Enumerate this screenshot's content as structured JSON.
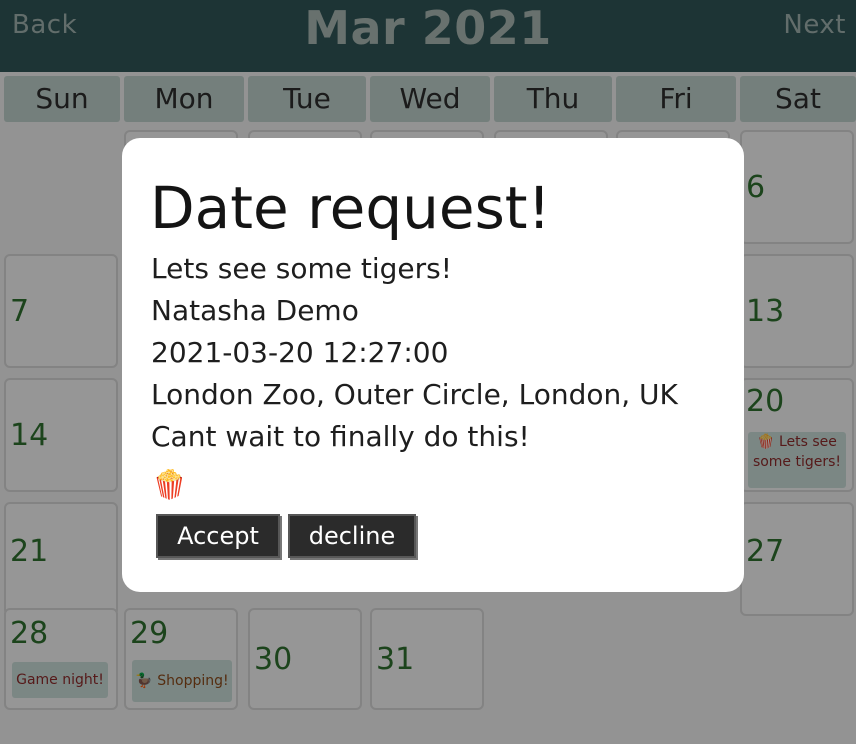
{
  "header": {
    "back_label": "Back",
    "month_title": "Mar 2021",
    "next_label": "Next"
  },
  "weekdays": [
    "Sun",
    "Mon",
    "Tue",
    "Wed",
    "Thu",
    "Fri",
    "Sat"
  ],
  "days": {
    "d6": "6",
    "d7": "7",
    "d13": "13",
    "d14": "14",
    "d20": "20",
    "d21": "21",
    "d27": "27",
    "d28": "28",
    "d29": "29",
    "d30": "30",
    "d31": "31"
  },
  "events": {
    "d20": {
      "icon": "🍿",
      "text": "Lets see some tigers!"
    },
    "d28": {
      "text": "Game night!"
    },
    "d29": {
      "icon": "🦆",
      "text": "Shopping!"
    }
  },
  "modal": {
    "title": "Date request!",
    "name": "Lets see some tigers!",
    "requester": "Natasha Demo",
    "datetime": "2021-03-20 12:27:00",
    "location": "London Zoo, Outer Circle, London, UK",
    "message": "Cant wait to finally do this!",
    "emoji": "🍿",
    "accept_label": "Accept",
    "decline_label": "decline"
  },
  "colors": {
    "header": "#2f5556",
    "day_number": "#2e6f2e",
    "event_bg": "#c7dad5",
    "button": "#2b2b2b"
  }
}
